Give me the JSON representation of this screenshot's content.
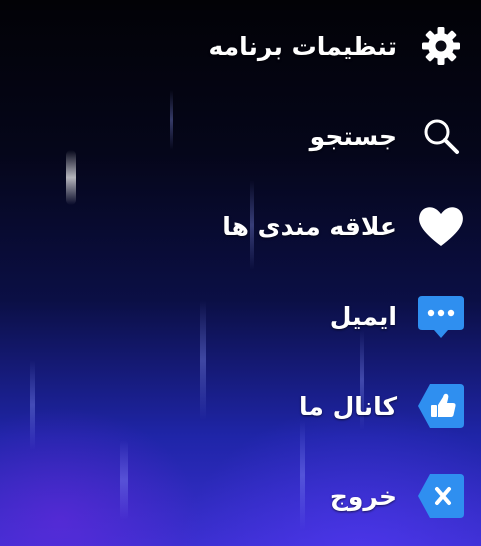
{
  "menu": {
    "items": [
      {
        "label": "تنظیمات برنامه",
        "icon": "gear-icon"
      },
      {
        "label": "جستجو",
        "icon": "search-icon"
      },
      {
        "label": "علاقه مندی ها",
        "icon": "heart-icon"
      },
      {
        "label": "ایمیل",
        "icon": "email-chat-icon"
      },
      {
        "label": "کانال ما",
        "icon": "thumbs-up-icon"
      },
      {
        "label": "خروج",
        "icon": "close-icon"
      }
    ]
  },
  "colors": {
    "text": "#ffffff",
    "badge_blue": "#2f8ff0",
    "background_top": "#020206",
    "background_bottom": "#3b2fd0"
  }
}
